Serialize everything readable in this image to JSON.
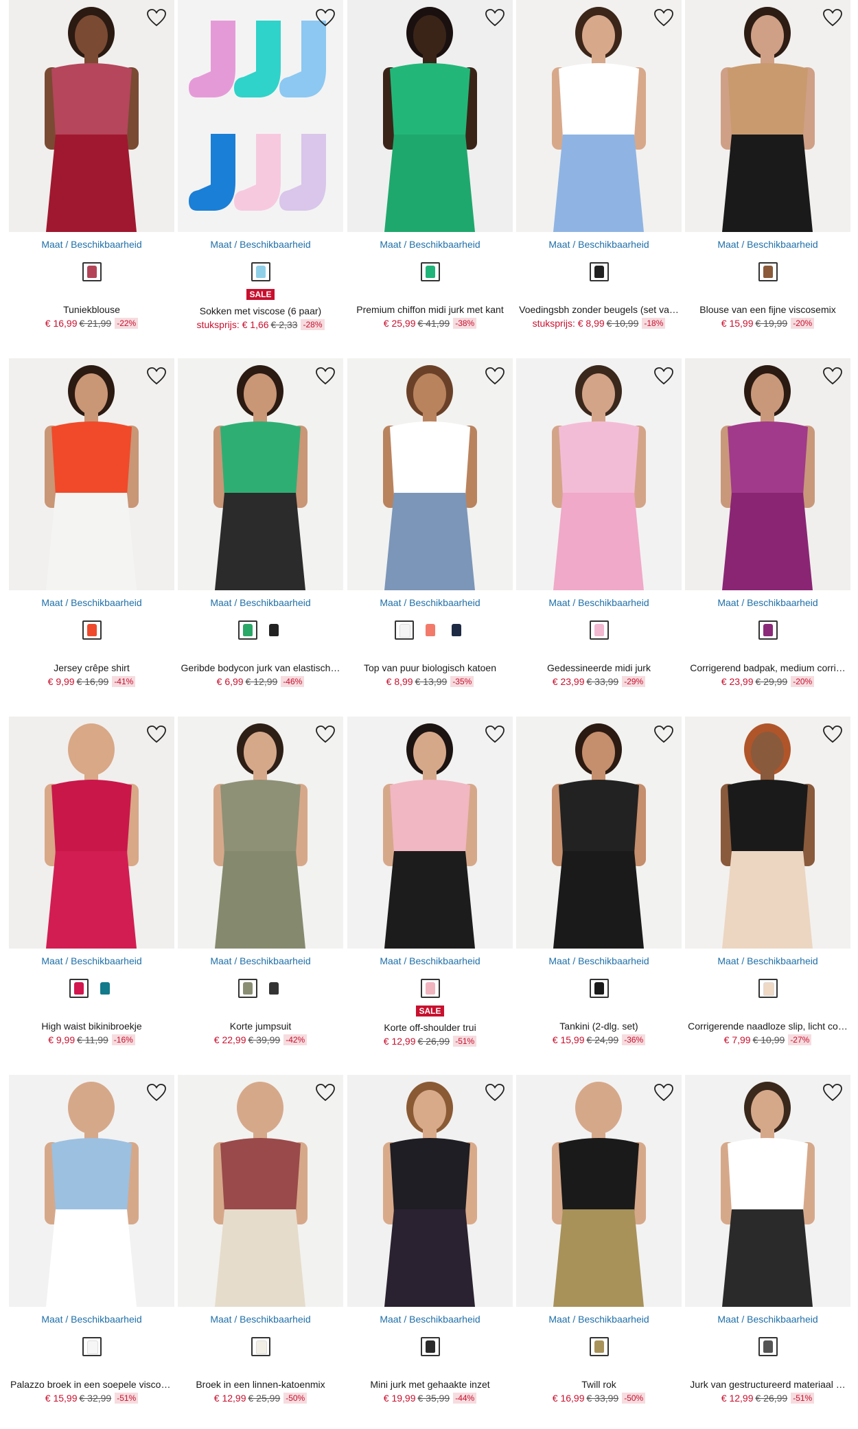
{
  "avail_label": "Maat / Beschikbaarheid",
  "sale_label": "SALE",
  "unit_prefix": "stuksprijs:",
  "wish_icon": "heart-outline-icon",
  "products": [
    {
      "name": "Tuniekblouse",
      "price": "€ 16,99",
      "old": "€ 21,99",
      "off": "-22%",
      "swatches": [
        "#b34458"
      ],
      "bg": "#f0efed",
      "c1": "#b5465c",
      "c2": "#a0182f",
      "skin": "#7a4a33",
      "hair": "#2a1a12"
    },
    {
      "name": "Sokken met viscose (6 paar)",
      "sale": true,
      "unit": true,
      "price": "€ 1,66",
      "old": "€ 2,33",
      "off": "-28%",
      "swatches": [
        "#8fd0e8"
      ],
      "bg": "#f3f3f3",
      "socks": true
    },
    {
      "name": "Premium chiffon midi jurk met kant",
      "price": "€ 25,99",
      "old": "€ 41,99",
      "off": "-38%",
      "swatches": [
        "#20b47a"
      ],
      "bg": "#efefef",
      "c1": "#22b778",
      "c2": "#1fa86d",
      "skin": "#3a2418",
      "hair": "#1a1010"
    },
    {
      "name": "Voedingsbh zonder beugels (set va…",
      "unit": true,
      "price": "€ 8,99",
      "old": "€ 10,99",
      "off": "-18%",
      "swatches": [
        "#222222"
      ],
      "bg": "#f2f1ef",
      "c1": "#ffffff",
      "c2": "#8fb4e3",
      "skin": "#d7a88a",
      "hair": "#3b2619"
    },
    {
      "name": "Blouse van een fijne viscosemix",
      "price": "€ 15,99",
      "old": "€ 19,99",
      "off": "-20%",
      "swatches": [
        "#8a5a3a"
      ],
      "bg": "#f1f0ee",
      "c1": "#c99a6e",
      "c2": "#1a1a1a",
      "skin": "#cfa086",
      "hair": "#2c1c14"
    },
    {
      "name": "Jersey crêpe shirt",
      "price": "€ 9,99",
      "old": "€ 16,99",
      "off": "-41%",
      "swatches": [
        "#ef4a2c"
      ],
      "bg": "#f1f0ee",
      "c1": "#f04a2a",
      "c2": "#f4f4f2",
      "skin": "#c99676",
      "hair": "#2b1a12"
    },
    {
      "name": "Geribde bodycon jurk van elastisch…",
      "price": "€ 6,99",
      "old": "€ 12,99",
      "off": "-46%",
      "swatches": [
        "#2aa868",
        "#222222"
      ],
      "bg": "#f2f2f0",
      "c1": "#2fae74",
      "c2": "#2b2b2b",
      "skin": "#c99676",
      "hair": "#2b1a12"
    },
    {
      "name": "Top van puur biologisch katoen",
      "price": "€ 8,99",
      "old": "€ 13,99",
      "off": "-35%",
      "swatches": [
        "#f4f4f4",
        "#f27a6a",
        "#1e2a44"
      ],
      "bg": "#f2f2f0",
      "c1": "#ffffff",
      "c2": "#7b96b8",
      "skin": "#b9835e",
      "hair": "#6a4128"
    },
    {
      "name": "Gedessineerde midi jurk",
      "price": "€ 23,99",
      "old": "€ 33,99",
      "off": "-29%",
      "swatches": [
        "#f2b8d0"
      ],
      "bg": "#f2f2f2",
      "c1": "#f3bcd6",
      "c2": "#f0a9c8",
      "skin": "#d4a488",
      "hair": "#3a281c"
    },
    {
      "name": "Corrigerend badpak, medium corri…",
      "price": "€ 23,99",
      "old": "€ 29,99",
      "off": "-20%",
      "swatches": [
        "#8c2a7a"
      ],
      "bg": "#f0efed",
      "c1": "#a13a8a",
      "c2": "#8a2574",
      "skin": "#c9987a",
      "hair": "#2b1a12"
    },
    {
      "name": "High waist bikinibroekje",
      "price": "€ 9,99",
      "old": "€ 11,99",
      "off": "-16%",
      "swatches": [
        "#d2164e",
        "#127a8a"
      ],
      "bg": "#f1efed",
      "c1": "#c9174a",
      "c2": "#d21d52",
      "skin": "#d8a887",
      "hair": "#d8a887"
    },
    {
      "name": "Korte jumpsuit",
      "price": "€ 22,99",
      "old": "€ 39,99",
      "off": "-42%",
      "swatches": [
        "#8a8f74",
        "#333333"
      ],
      "bg": "#f2f2f0",
      "c1": "#8e9176",
      "c2": "#858a6e",
      "skin": "#d6a88a",
      "hair": "#2e1f16"
    },
    {
      "name": "Korte off-shoulder trui",
      "sale": true,
      "price": "€ 12,99",
      "old": "€ 26,99",
      "off": "-51%",
      "swatches": [
        "#f0b4bf"
      ],
      "bg": "#f2f2f2",
      "c1": "#f1b7c2",
      "c2": "#1c1c1c",
      "skin": "#d6a88a",
      "hair": "#1c1412"
    },
    {
      "name": "Tankini (2-dlg. set)",
      "price": "€ 15,99",
      "old": "€ 24,99",
      "off": "-36%",
      "swatches": [
        "#1a1a1a"
      ],
      "bg": "#f2f2f0",
      "c1": "#222222",
      "c2": "#1a1a1a",
      "skin": "#c58e6c",
      "hair": "#2b1a12"
    },
    {
      "name": "Corrigerende naadloze slip, licht co…",
      "price": "€ 7,99",
      "old": "€ 10,99",
      "off": "-27%",
      "swatches": [
        "#efd8c4"
      ],
      "bg": "#f2f1ef",
      "c1": "#1a1a1a",
      "c2": "#ecd6c1",
      "skin": "#8a5a3c",
      "hair": "#b0552a"
    },
    {
      "name": "Palazzo broek in een soepele viscos…",
      "price": "€ 15,99",
      "old": "€ 32,99",
      "off": "-51%",
      "swatches": [
        "#f6f6f6"
      ],
      "bg": "#f2f2f2",
      "c1": "#9cc0e0",
      "c2": "#ffffff",
      "skin": "#d6a88a",
      "hair": "#d6a88a"
    },
    {
      "name": "Broek in een linnen-katoenmix",
      "price": "€ 12,99",
      "old": "€ 25,99",
      "off": "-50%",
      "swatches": [
        "#f2efe6"
      ],
      "bg": "#f2f2f0",
      "c1": "#9a4a4a",
      "c2": "#e6dccb",
      "skin": "#d6a88a",
      "hair": "#d6a88a"
    },
    {
      "name": "Mini jurk met gehaakte inzet",
      "price": "€ 19,99",
      "old": "€ 35,99",
      "off": "-44%",
      "swatches": [
        "#2a2a2a"
      ],
      "bg": "#f1f1f1",
      "c1": "#1e1e24",
      "c2": "#2a2230",
      "skin": "#d9aa8a",
      "hair": "#8a5a34"
    },
    {
      "name": "Twill rok",
      "price": "€ 16,99",
      "old": "€ 33,99",
      "off": "-50%",
      "swatches": [
        "#a8935a"
      ],
      "bg": "#f2f2f2",
      "c1": "#1a1a1a",
      "c2": "#a8925a",
      "skin": "#d6a88a",
      "hair": "#d6a88a"
    },
    {
      "name": "Jurk van gestructureerd materiaal …",
      "price": "€ 12,99",
      "old": "€ 26,99",
      "off": "-51%",
      "swatches": [
        "#555555"
      ],
      "bg": "#f2f2f2",
      "c1": "#ffffff",
      "c2": "#2a2a2a",
      "skin": "#d6a88a",
      "hair": "#3a281c"
    }
  ]
}
